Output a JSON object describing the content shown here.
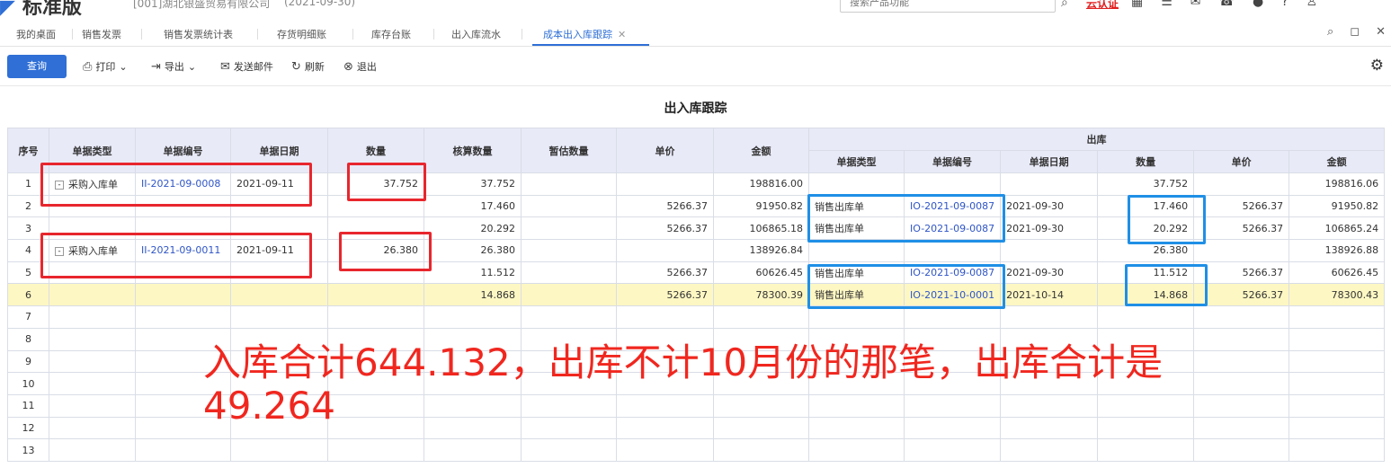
{
  "header": {
    "brand": "标准版",
    "company": "[001]湖北银盛贸易有限公司",
    "period": "(2021-09-30)",
    "search_placeholder": "搜索产品功能",
    "cloud_link": "云认证"
  },
  "tabs": [
    {
      "label": "我的桌面"
    },
    {
      "label": "销售发票"
    },
    {
      "label": "销售发票统计表"
    },
    {
      "label": "存货明细账"
    },
    {
      "label": "库存台账"
    },
    {
      "label": "出入库流水"
    },
    {
      "label": "成本出入库跟踪"
    }
  ],
  "toolbar": {
    "query": "查询",
    "print": "打印",
    "export": "导出",
    "email": "发送邮件",
    "refresh": "刷新",
    "exit": "退出"
  },
  "report": {
    "title": "出入库跟踪"
  },
  "table": {
    "headers": {
      "seq": "序号",
      "doc_type": "单据类型",
      "doc_no": "单据编号",
      "doc_date": "单据日期",
      "qty": "数量",
      "check_qty": "核算数量",
      "est_qty": "暂估数量",
      "price": "单价",
      "amount": "金额",
      "out_group": "出库",
      "out_doc_type": "单据类型",
      "out_doc_no": "单据编号",
      "out_doc_date": "单据日期",
      "out_qty": "数量",
      "out_price": "单价",
      "out_amount": "金额"
    },
    "rows": [
      {
        "seq": "1",
        "expander": "-",
        "doc_type": "采购入库单",
        "doc_no": "II-2021-09-0008",
        "doc_date": "2021-09-11",
        "qty": "37.752",
        "check_qty": "37.752",
        "est_qty": "",
        "price": "",
        "amount": "198816.00",
        "out_doc_type": "",
        "out_doc_no": "",
        "out_doc_date": "",
        "out_qty": "37.752",
        "out_price": "",
        "out_amount": "198816.06"
      },
      {
        "seq": "2",
        "expander": "",
        "doc_type": "",
        "doc_no": "",
        "doc_date": "",
        "qty": "",
        "check_qty": "17.460",
        "est_qty": "",
        "price": "5266.37",
        "amount": "91950.82",
        "out_doc_type": "销售出库单",
        "out_doc_no": "IO-2021-09-0087",
        "out_doc_date": "2021-09-30",
        "out_qty": "17.460",
        "out_price": "5266.37",
        "out_amount": "91950.82"
      },
      {
        "seq": "3",
        "expander": "",
        "doc_type": "",
        "doc_no": "",
        "doc_date": "",
        "qty": "",
        "check_qty": "20.292",
        "est_qty": "",
        "price": "5266.37",
        "amount": "106865.18",
        "out_doc_type": "销售出库单",
        "out_doc_no": "IO-2021-09-0087",
        "out_doc_date": "2021-09-30",
        "out_qty": "20.292",
        "out_price": "5266.37",
        "out_amount": "106865.24"
      },
      {
        "seq": "4",
        "expander": "-",
        "doc_type": "采购入库单",
        "doc_no": "II-2021-09-0011",
        "doc_date": "2021-09-11",
        "qty": "26.380",
        "check_qty": "26.380",
        "est_qty": "",
        "price": "",
        "amount": "138926.84",
        "out_doc_type": "",
        "out_doc_no": "",
        "out_doc_date": "",
        "out_qty": "26.380",
        "out_price": "",
        "out_amount": "138926.88"
      },
      {
        "seq": "5",
        "expander": "",
        "doc_type": "",
        "doc_no": "",
        "doc_date": "",
        "qty": "",
        "check_qty": "11.512",
        "est_qty": "",
        "price": "5266.37",
        "amount": "60626.45",
        "out_doc_type": "销售出库单",
        "out_doc_no": "IO-2021-09-0087",
        "out_doc_date": "2021-09-30",
        "out_qty": "11.512",
        "out_price": "5266.37",
        "out_amount": "60626.45"
      },
      {
        "seq": "6",
        "expander": "",
        "doc_type": "",
        "doc_no": "",
        "doc_date": "",
        "qty": "",
        "check_qty": "14.868",
        "est_qty": "",
        "price": "5266.37",
        "amount": "78300.39",
        "out_doc_type": "销售出库单",
        "out_doc_no": "IO-2021-10-0001",
        "out_doc_date": "2021-10-14",
        "out_qty": "14.868",
        "out_price": "5266.37",
        "out_amount": "78300.43"
      },
      {
        "seq": "7"
      },
      {
        "seq": "8"
      },
      {
        "seq": "9"
      },
      {
        "seq": "10"
      },
      {
        "seq": "11"
      },
      {
        "seq": "12"
      },
      {
        "seq": "13"
      }
    ]
  },
  "annotation": {
    "line1": "入库合计644.132，出库不计10月份的那笔，出库合计是",
    "line2": "49.264",
    "red": "#e8262d",
    "blue": "#1f8fe6"
  }
}
